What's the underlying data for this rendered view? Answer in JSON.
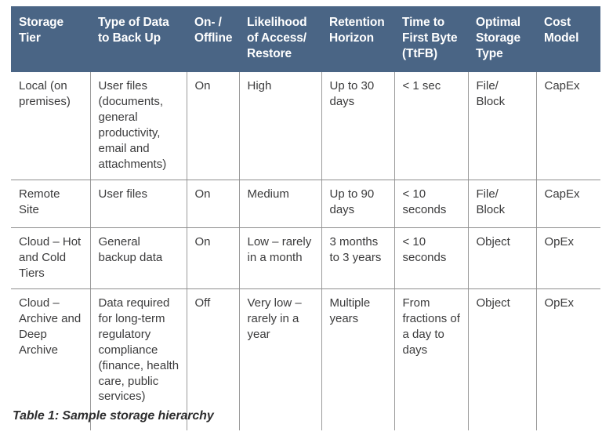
{
  "table": {
    "columns": [
      "Storage Tier",
      "Type of Data to Back Up",
      "On- / Offline",
      "Likelihood of Access/ Restore",
      "Retention Horizon",
      "Time to First Byte (TtFB)",
      "Optimal Storage Type",
      "Cost Model"
    ],
    "rows": [
      {
        "storage_tier": "Local (on premises)",
        "type_of_data": "User files (documents, general productivity, email and attachments)",
        "on_offline": "On",
        "likelihood": "High",
        "retention": "Up to 30 days",
        "ttfb": "< 1 sec",
        "optimal_storage": "File/ Block",
        "cost_model": "CapEx"
      },
      {
        "storage_tier": "Remote Site",
        "type_of_data": "User files",
        "on_offline": "On",
        "likelihood": "Medium",
        "retention": "Up to 90 days",
        "ttfb": "< 10 seconds",
        "optimal_storage": "File/ Block",
        "cost_model": "CapEx"
      },
      {
        "storage_tier": "Cloud – Hot and Cold Tiers",
        "type_of_data": "General backup data",
        "on_offline": "On",
        "likelihood": "Low – rarely in a month",
        "retention": "3 months to 3 years",
        "ttfb": "< 10 seconds",
        "optimal_storage": "Object",
        "cost_model": "OpEx"
      },
      {
        "storage_tier": "Cloud – Archive and Deep Archive",
        "type_of_data": "Data required for long-term regulatory compliance (finance, health care, public services)",
        "on_offline": "Off",
        "likelihood": "Very low – rarely in a year",
        "retention": "Multiple years",
        "ttfb": "From fractions of a day to days",
        "optimal_storage": "Object",
        "cost_model": "OpEx"
      }
    ]
  },
  "caption": "Table 1: Sample storage hierarchy",
  "colors": {
    "header_background": "#4a6585",
    "header_text": "#ffffff",
    "body_text": "#3b3b3c",
    "grid_line": "#8e8e8e",
    "page_background": "#ffffff"
  }
}
